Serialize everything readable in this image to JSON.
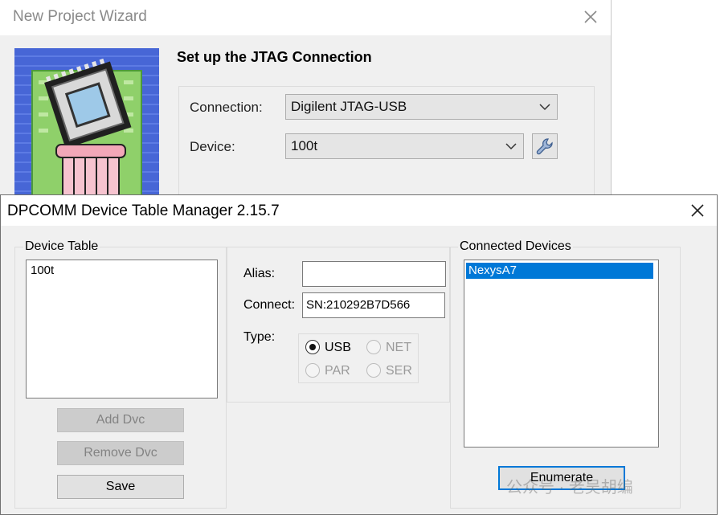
{
  "wizard": {
    "title": "New Project Wizard",
    "heading": "Set up the JTAG Connection",
    "connection_label": "Connection:",
    "connection_value": "Digilent JTAG-USB",
    "device_label": "Device:",
    "device_value": "100t"
  },
  "dialog": {
    "title": "DPCOMM Device Table Manager 2.15.7",
    "device_table": {
      "label": "Device Table",
      "items": [
        "100t"
      ]
    },
    "buttons": {
      "add": "Add Dvc",
      "remove": "Remove Dvc",
      "save": "Save",
      "enumerate": "Enumerate"
    },
    "fields": {
      "alias_label": "Alias:",
      "alias_value": "",
      "connect_label": "Connect:",
      "connect_value": "SN:210292B7D566",
      "type_label": "Type:"
    },
    "type_options": [
      "USB",
      "NET",
      "PAR",
      "SER"
    ],
    "type_selected": "USB",
    "connected_devices": {
      "label": "Connected Devices",
      "items": [
        "NexysA7"
      ],
      "selected": "NexysA7"
    }
  },
  "watermark": "公众号 · 老吴胡编",
  "colors": {
    "selection": "#0078d7",
    "window_bg": "#f0f0f0",
    "focus_border": "#0078d7"
  }
}
